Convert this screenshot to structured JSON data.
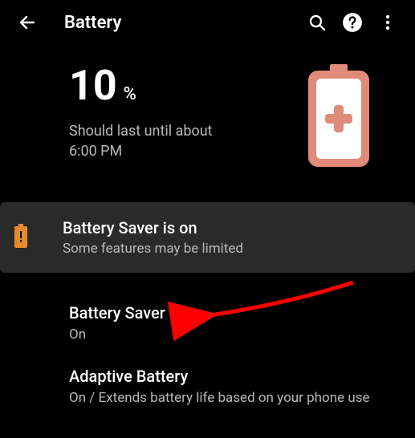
{
  "appbar": {
    "title": "Battery"
  },
  "hero": {
    "percent_value": "10",
    "percent_sign": "%",
    "estimate_line1": "Should last until about",
    "estimate_line2": "6:00 PM"
  },
  "banner": {
    "title": "Battery Saver is on",
    "subtitle": "Some features may be limited"
  },
  "items": {
    "battery_saver": {
      "title": "Battery Saver",
      "sub": "On"
    },
    "adaptive": {
      "title": "Adaptive Battery",
      "sub": "On / Extends battery life based on your phone use"
    }
  },
  "colors": {
    "accent": "#e08b7a",
    "orange": "#e68a2e"
  }
}
